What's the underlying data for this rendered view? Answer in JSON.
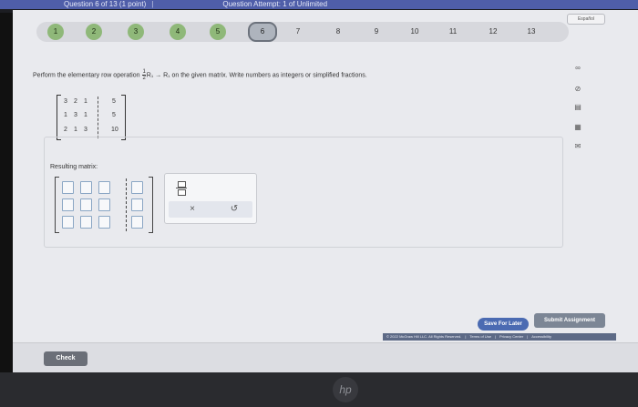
{
  "header": {
    "question_label": "Question 6 of 13 (1 point)",
    "attempt_label": "Question Attempt: 1 of Unlimited"
  },
  "pager": {
    "pages": [
      "1",
      "2",
      "3",
      "4",
      "5",
      "6",
      "7",
      "8",
      "9",
      "10",
      "11",
      "12",
      "13"
    ],
    "current_page": "6",
    "completed_pages": [
      "1",
      "2",
      "3",
      "4",
      "5"
    ]
  },
  "language_button": "Español",
  "problem": {
    "instruction_prefix": "Perform the elementary row operation",
    "frac_num": "1",
    "frac_den": "2",
    "operation": "R₁ → R₁",
    "instruction_suffix": "on the given matrix. Write numbers as integers or simplified fractions.",
    "matrix": [
      [
        "3",
        "2",
        "1",
        "5"
      ],
      [
        "1",
        "3",
        "1",
        "5"
      ],
      [
        "2",
        "1",
        "3",
        "10"
      ]
    ]
  },
  "answer": {
    "label": "Resulting matrix:"
  },
  "palette": {
    "fraction_tool": "fraction-icon",
    "clear_symbol": "×",
    "undo_symbol": "↺"
  },
  "side_tools": [
    "∞",
    "⊘",
    "▤",
    "▦",
    "✉"
  ],
  "buttons": {
    "save": "Save For Later",
    "submit": "Submit Assignment",
    "check": "Check"
  },
  "footer": {
    "copyright": "© 2022 McGraw Hill LLC. All Rights Reserved.",
    "terms": "Terms of Use",
    "privacy": "Privacy Center",
    "accessibility": "Accessibility"
  },
  "colors": {
    "accent": "#4f5ea9",
    "completed": "#8fb879",
    "save_button": "#4b6bb2"
  }
}
